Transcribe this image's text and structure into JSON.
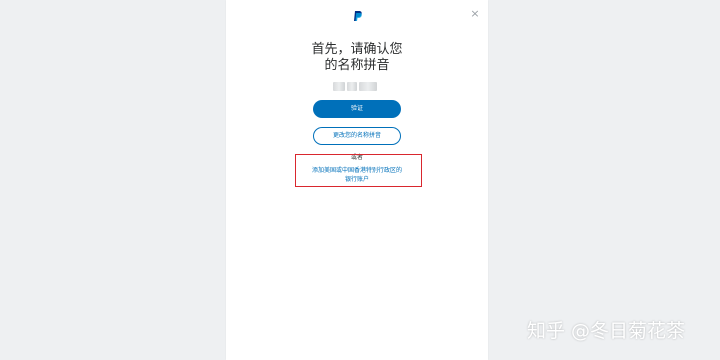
{
  "header": {
    "logo_icon": "paypal-logo-icon",
    "close_icon": "close-icon",
    "close_glyph": "×"
  },
  "main": {
    "title_line1": "首先，请确认您",
    "title_line2": "的名称拼音",
    "name_placeholder_visual": "blurred-name",
    "verify_button": "验证",
    "change_name_button": "更改您的名称拼音",
    "or_text": "或者",
    "bank_link_line1": "添加美国或中国香港特别行政区的",
    "bank_link_line2": "银行账户"
  },
  "overlay": {
    "watermark": "知乎 @冬日菊花茶"
  },
  "colors": {
    "primary": "#0070ba",
    "highlight": "#d9272e",
    "background": "#eef0f2",
    "panel": "#ffffff",
    "text": "#2c2e2f"
  }
}
